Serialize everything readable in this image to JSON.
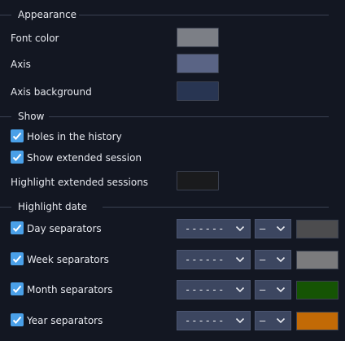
{
  "sections": {
    "appearance": "Appearance",
    "show": "Show",
    "highlight_date": "Highlight date"
  },
  "appearance": {
    "font_color": {
      "label": "Font color",
      "color": "#7c7f86"
    },
    "axis": {
      "label": "Axis",
      "color": "#5a6485"
    },
    "axis_background": {
      "label": "Axis background",
      "color": "#283552"
    }
  },
  "show": {
    "holes": {
      "label": "Holes in the history",
      "checked": true
    },
    "extended": {
      "label": "Show extended session",
      "checked": true
    },
    "highlight_extended": {
      "label": "Highlight extended sessions",
      "color": "#1a1b1d"
    }
  },
  "highlight_date": {
    "rows": [
      {
        "label": "Day separators",
        "style": "------",
        "width": "—",
        "color": "#4c4c4e",
        "checked": true
      },
      {
        "label": "Week separators",
        "style": "------",
        "width": "—",
        "color": "#7b7b7d",
        "checked": true
      },
      {
        "label": "Month separators",
        "style": "------",
        "width": "—",
        "color": "#155404",
        "checked": true
      },
      {
        "label": "Year separators",
        "style": "------",
        "width": "—",
        "color": "#c26a06",
        "checked": true
      }
    ]
  }
}
